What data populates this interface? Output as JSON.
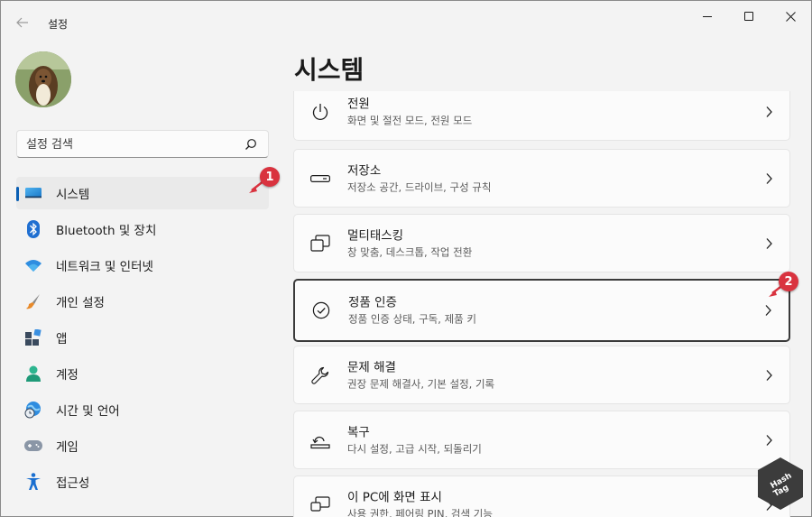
{
  "window": {
    "title": "설정"
  },
  "sidebar": {
    "search_placeholder": "설정 검색",
    "items": [
      {
        "label": "시스템",
        "icon": "monitor-icon",
        "selected": true
      },
      {
        "label": "Bluetooth 및 장치",
        "icon": "bluetooth-icon"
      },
      {
        "label": "네트워크 및 인터넷",
        "icon": "wifi-icon"
      },
      {
        "label": "개인 설정",
        "icon": "brush-icon"
      },
      {
        "label": "앱",
        "icon": "apps-icon"
      },
      {
        "label": "계정",
        "icon": "person-icon"
      },
      {
        "label": "시간 및 언어",
        "icon": "globe-clock-icon"
      },
      {
        "label": "게임",
        "icon": "gamepad-icon"
      },
      {
        "label": "접근성",
        "icon": "accessibility-icon"
      }
    ]
  },
  "main": {
    "title": "시스템",
    "cards": [
      {
        "title": "전원",
        "subtitle": "화면 및 절전 모드, 전원 모드",
        "icon": "power-icon"
      },
      {
        "title": "저장소",
        "subtitle": "저장소 공간, 드라이브, 구성 규칙",
        "icon": "storage-icon"
      },
      {
        "title": "멀티태스킹",
        "subtitle": "창 맞춤, 데스크톱, 작업 전환",
        "icon": "multitasking-icon"
      },
      {
        "title": "정품 인증",
        "subtitle": "정품 인증 상태, 구독, 제품 키",
        "icon": "check-circle-icon",
        "focused": true
      },
      {
        "title": "문제 해결",
        "subtitle": "권장 문제 해결사, 기본 설정, 기록",
        "icon": "wrench-icon"
      },
      {
        "title": "복구",
        "subtitle": "다시 설정, 고급 시작, 되돌리기",
        "icon": "recovery-icon"
      },
      {
        "title": "이 PC에 화면 표시",
        "subtitle": "사용 권한, 페어링 PIN, 검색 기능",
        "icon": "project-icon"
      }
    ]
  },
  "annotations": {
    "badge1": "1",
    "badge2": "2",
    "color": "#d9333f"
  },
  "watermark": {
    "line1": "Hash",
    "line2": "Tag"
  }
}
